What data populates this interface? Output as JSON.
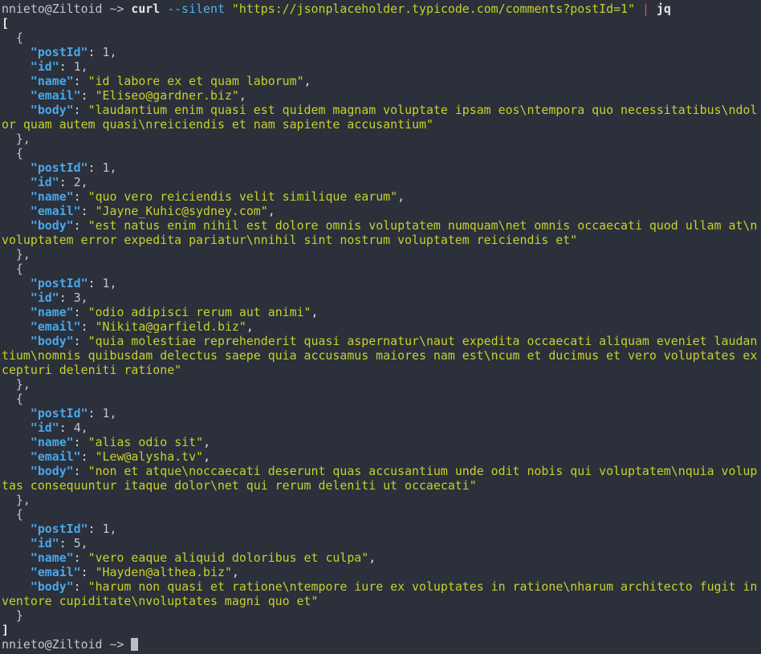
{
  "terminal": {
    "prompt": "nnieto@Ziltoid ~> ",
    "command": {
      "program": "curl",
      "flag": "--silent",
      "url": "\"https://jsonplaceholder.typicode.com/comments?postId=1\"",
      "pipe": "|",
      "filter": "jq"
    },
    "cursor": "cursor-block"
  },
  "output": {
    "open_bracket": "[",
    "close_bracket": "]",
    "keys": {
      "postId": "\"postId\"",
      "id": "\"id\"",
      "name": "\"name\"",
      "email": "\"email\"",
      "body": "\"body\""
    },
    "comments": [
      {
        "postId": "1,",
        "id": "1,",
        "name": "\"id labore ex et quam laborum\"",
        "email": "\"Eliseo@gardner.biz\"",
        "body_line1": "\"laudantium enim quasi est quidem magnam voluptate ipsam eos\\ntempora quo necessitatibus\\ndol",
        "body_line2": "or quam autem quasi\\nreiciendis et nam sapiente accusantium\"",
        "body_line3": ""
      },
      {
        "postId": "1,",
        "id": "2,",
        "name": "\"quo vero reiciendis velit similique earum\"",
        "email": "\"Jayne_Kuhic@sydney.com\"",
        "body_line1": "\"est natus enim nihil est dolore omnis voluptatem numquam\\net omnis occaecati quod ullam at\\n",
        "body_line2": "voluptatem error expedita pariatur\\nnihil sint nostrum voluptatem reiciendis et\"",
        "body_line3": ""
      },
      {
        "postId": "1,",
        "id": "3,",
        "name": "\"odio adipisci rerum aut animi\"",
        "email": "\"Nikita@garfield.biz\"",
        "body_line1": "\"quia molestiae reprehenderit quasi aspernatur\\naut expedita occaecati aliquam eveniet laudan",
        "body_line2": "tium\\nomnis quibusdam delectus saepe quia accusamus maiores nam est\\ncum et ducimus et vero voluptates ex",
        "body_line3": "cepturi deleniti ratione\""
      },
      {
        "postId": "1,",
        "id": "4,",
        "name": "\"alias odio sit\"",
        "email": "\"Lew@alysha.tv\"",
        "body_line1": "\"non et atque\\noccaecati deserunt quas accusantium unde odit nobis qui voluptatem\\nquia volup",
        "body_line2": "tas consequuntur itaque dolor\\net qui rerum deleniti ut occaecati\"",
        "body_line3": ""
      },
      {
        "postId": "1,",
        "id": "5,",
        "name": "\"vero eaque aliquid doloribus et culpa\"",
        "email": "\"Hayden@althea.biz\"",
        "body_line1": "\"harum non quasi et ratione\\ntempore iure ex voluptates in ratione\\nharum architecto fugit in",
        "body_line2": "ventore cupiditate\\nvoluptates magni quo et\"",
        "body_line3": ""
      }
    ]
  }
}
